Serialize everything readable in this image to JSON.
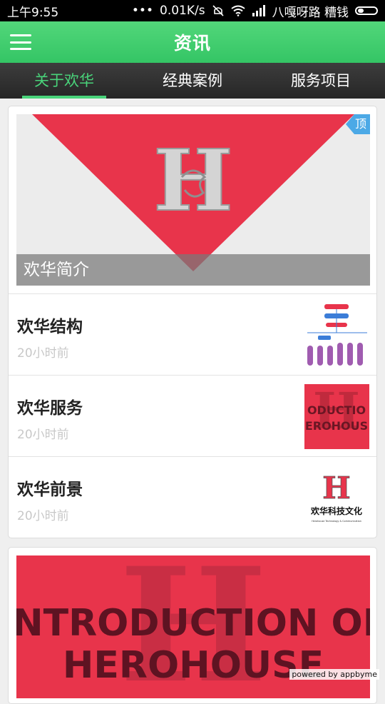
{
  "status": {
    "time": "上午9:55",
    "network": "0.01K/s",
    "carrier": "八嘎呀路 糟钱"
  },
  "appbar": {
    "title": "资讯"
  },
  "tabs": [
    {
      "label": "关于欢华",
      "active": true
    },
    {
      "label": "经典案例"
    },
    {
      "label": "服务项目"
    }
  ],
  "featured": {
    "caption": "欢华简介",
    "badge": "顶",
    "logo_letter": "H"
  },
  "news": [
    {
      "title": "欢华结构",
      "time": "20小时前"
    },
    {
      "title": "欢华服务",
      "time": "20小时前",
      "thumb_text": [
        "ODUCTIO",
        "EROHOUS"
      ]
    },
    {
      "title": "欢华前景",
      "time": "20小时前",
      "thumb_brand": "欢华科技文化",
      "thumb_sub": "Herohouse Technology & Communication"
    }
  ],
  "second_card": {
    "line1": "INTRODUCTION OF",
    "line2": "HEROHOUSE"
  },
  "footer": {
    "powered": "powered by appbyme"
  },
  "colors": {
    "green": "#3fcd6e",
    "red": "#e8344b",
    "blue": "#4ca9e6"
  }
}
